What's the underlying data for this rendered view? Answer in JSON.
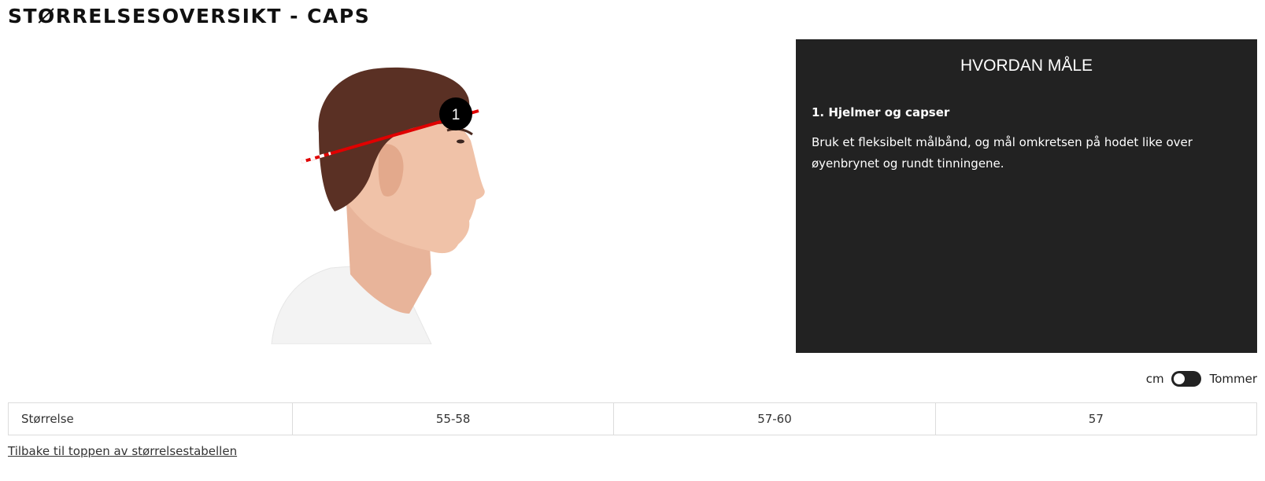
{
  "page": {
    "title": "STØRRELSESOVERSIKT - CAPS"
  },
  "figure": {
    "marker_label": "1",
    "line_color": "#e00000"
  },
  "how_to_measure": {
    "title": "HVORDAN MÅLE",
    "step_title": "1. Hjelmer og capser",
    "step_text": "Bruk et fleksibelt målbånd, og mål omkretsen på hodet like over øyenbrynet og rundt tinningene.",
    "background": "#222222"
  },
  "unit_toggle": {
    "left_label": "cm",
    "right_label": "Tommer",
    "selected": "cm"
  },
  "size_table": {
    "row_label": "Størrelse",
    "values": [
      "55-58",
      "57-60",
      "57"
    ]
  },
  "back_link": "Tilbake til toppen av størrelsestabellen"
}
